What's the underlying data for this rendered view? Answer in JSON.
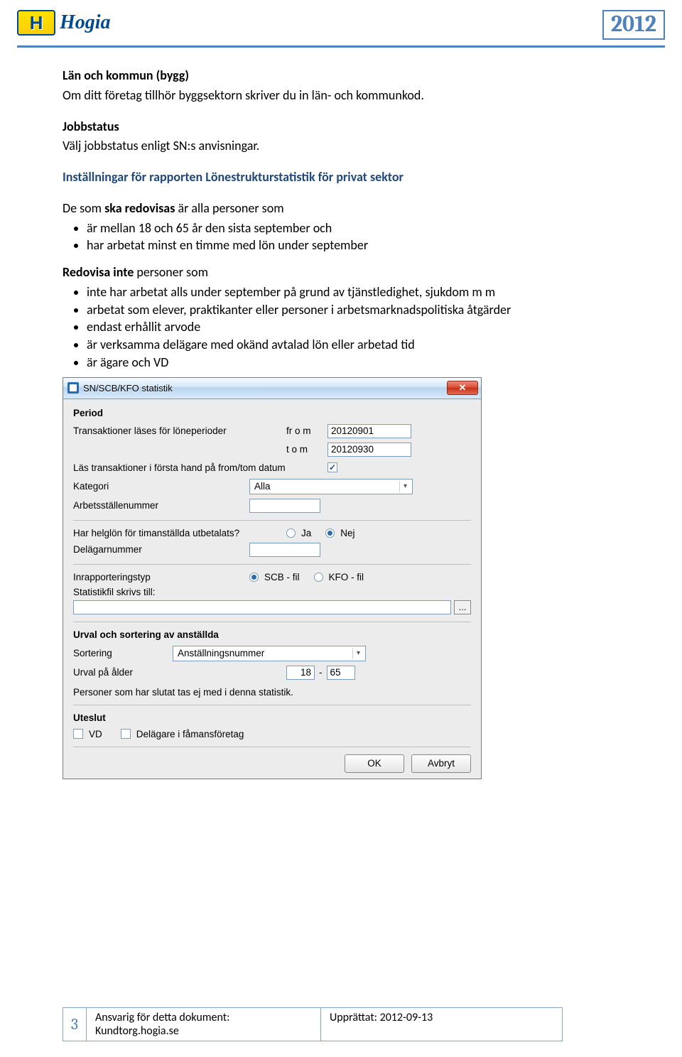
{
  "header": {
    "logo_h": "H",
    "brand": "Hogia",
    "year": "2012"
  },
  "doc": {
    "h1": "Län och kommun (bygg)",
    "p1": "Om ditt företag tillhör byggsektorn skriver du in län- och kommunkod.",
    "h2": "Jobbstatus",
    "p2": "Välj jobbstatus enligt SN:s anvisningar.",
    "h3": "Inställningar för rapporten Lönestrukturstatistik för privat sektor",
    "de_som": "De som ",
    "ska_red": "ska redovisas",
    "de_som_tail": " är alla personer som",
    "bul_a": [
      "är mellan 18 och 65 år den sista september och",
      "har arbetat minst en timme med lön under september"
    ],
    "red_inte": "Redovisa inte",
    "red_inte_tail": " personer som",
    "bul_b": [
      "inte har arbetat alls under september på grund av tjänstledighet, sjukdom m m",
      "arbetat som elever, praktikanter eller personer i arbetsmarknadspolitiska åtgärder",
      "endast erhållit arvode",
      "är verksamma delägare med okänd avtalad lön eller arbetad tid",
      "är ägare och VD"
    ]
  },
  "dialog": {
    "title": "SN/SCB/KFO statistik",
    "period": {
      "group": "Period",
      "readLine": "Transaktioner läses för löneperioder",
      "from_lbl": "fr o m",
      "to_lbl": "t o m",
      "from_val": "20120901",
      "to_val": "20120930",
      "readFirst": "Läs transaktioner i första hand på from/tom datum",
      "checked": "✓",
      "kategori_lbl": "Kategori",
      "kategori_val": "Alla",
      "arbetsst_lbl": "Arbetsställenummer",
      "arbetsst_val": ""
    },
    "helg": {
      "label": "Har helglön för timanställda utbetalats?",
      "ja": "Ja",
      "nej": "Nej",
      "delag_lbl": "Delägarnummer",
      "delag_val": ""
    },
    "rapport": {
      "typ_lbl": "Inrapporteringstyp",
      "scb": "SCB - fil",
      "kfo": "KFO - fil",
      "skrivs_lbl": "Statistikfil skrivs till:",
      "path_val": "",
      "browse": "..."
    },
    "urval": {
      "group": "Urval och sortering av anställda",
      "sort_lbl": "Sortering",
      "sort_val": "Anställningsnummer",
      "alder_lbl": "Urval på ålder",
      "alder_from": "18",
      "alder_to": "65",
      "slutat": "Personer som har slutat tas ej med i denna statistik."
    },
    "uteslut": {
      "group": "Uteslut",
      "vd": "VD",
      "delag": "Delägare i fåmansföretag"
    },
    "buttons": {
      "ok": "OK",
      "cancel": "Avbryt"
    }
  },
  "footer": {
    "page": "3",
    "resp_lbl": "Ansvarig för detta dokument:",
    "resp_val": "Kundtorg.hogia.se",
    "date_lbl": "Upprättat: ",
    "date_val": "2012-09-13"
  }
}
